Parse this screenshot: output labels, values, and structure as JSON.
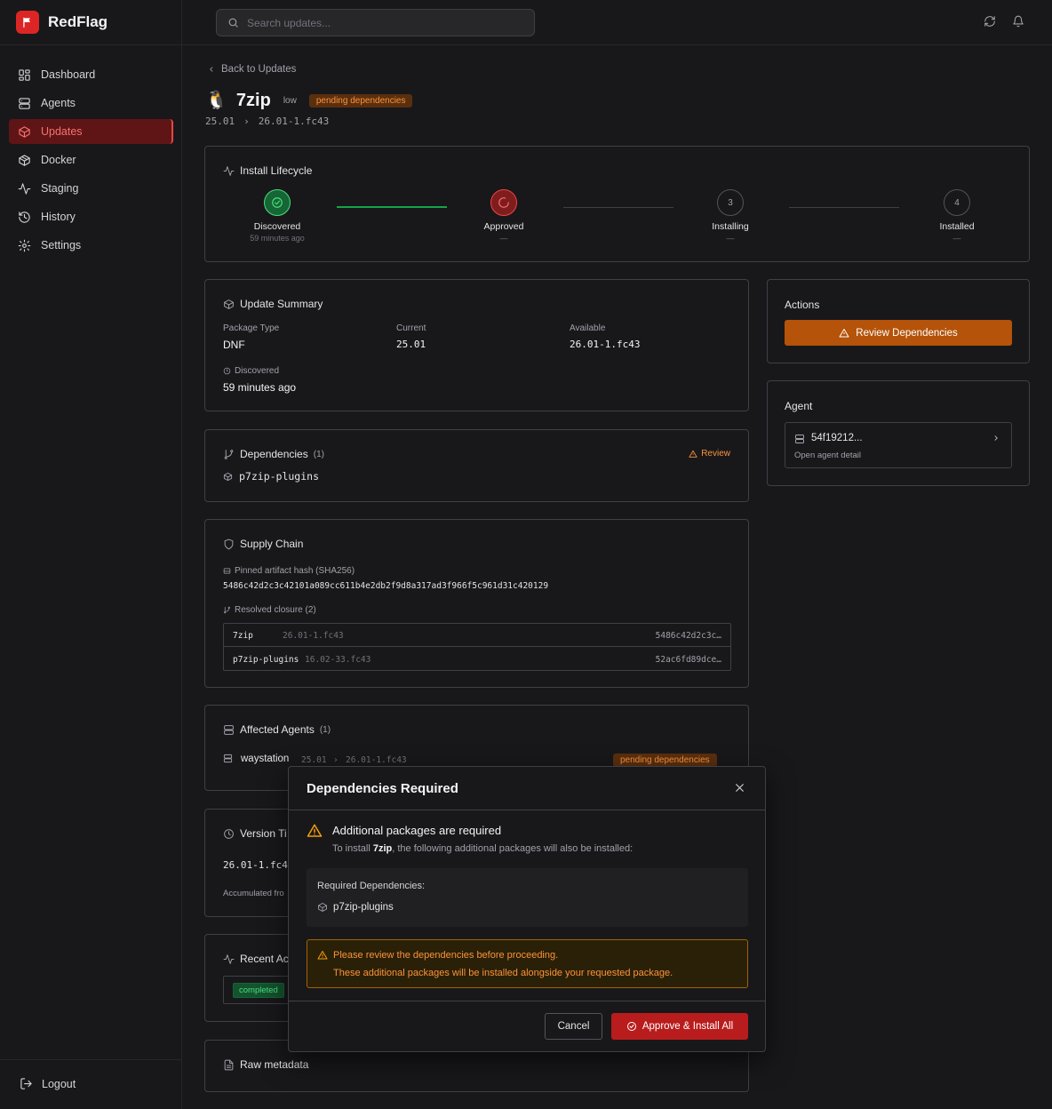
{
  "app": {
    "name": "RedFlag"
  },
  "nav": {
    "items": [
      {
        "label": "Dashboard",
        "icon": "layout-dashboard-icon"
      },
      {
        "label": "Agents",
        "icon": "server-icon"
      },
      {
        "label": "Updates",
        "icon": "package-icon",
        "active": true
      },
      {
        "label": "Docker",
        "icon": "container-icon"
      },
      {
        "label": "Staging",
        "icon": "activity-icon"
      },
      {
        "label": "History",
        "icon": "history-icon"
      },
      {
        "label": "Settings",
        "icon": "gear-icon"
      }
    ],
    "logout": "Logout"
  },
  "topbar": {
    "search_placeholder": "Search updates..."
  },
  "header": {
    "back": "Back to Updates",
    "package": "7zip",
    "severity": "low",
    "status": "pending dependencies",
    "current_version": "25.01",
    "arrow": "›",
    "available_version": "26.01-1.fc43"
  },
  "lifecycle": {
    "title": "Install Lifecycle",
    "stages": [
      {
        "label": "Discovered",
        "sub": "59 minutes ago",
        "state": "done"
      },
      {
        "label": "Approved",
        "sub": "—",
        "state": "current"
      },
      {
        "label": "Installing",
        "sub": "—",
        "state": "pending",
        "num": "3"
      },
      {
        "label": "Installed",
        "sub": "—",
        "state": "pending",
        "num": "4"
      }
    ]
  },
  "summary": {
    "title": "Update Summary",
    "package_type_label": "Package Type",
    "package_type": "DNF",
    "current_label": "Current",
    "current": "25.01",
    "available_label": "Available",
    "available": "26.01-1.fc43",
    "discovered_label": "Discovered",
    "discovered": "59 minutes ago"
  },
  "dependencies": {
    "title": "Dependencies",
    "count": "(1)",
    "review": "Review",
    "items": [
      "p7zip-plugins"
    ]
  },
  "supply_chain": {
    "title": "Supply Chain",
    "hash_label": "Pinned artifact hash (SHA256)",
    "hash": "5486c42d2c3c42101a089cc611b4e2db2f9d8a317ad3f966f5c961d31c420129",
    "closure_label": "Resolved closure (2)",
    "closure": [
      {
        "name": "7zip",
        "version": "26.01-1.fc43",
        "hash": "5486c42d2c3c…"
      },
      {
        "name": "p7zip-plugins",
        "version": "16.02-33.fc43",
        "hash": "52ac6fd89dce…"
      }
    ]
  },
  "affected": {
    "title": "Affected Agents",
    "count": "(1)",
    "agent": "waystation",
    "from": "25.01",
    "arrow": "›",
    "to": "26.01-1.fc43",
    "status": "pending dependencies"
  },
  "version_timeline": {
    "title": "Version Ti",
    "value": "26.01-1.fc4",
    "footer": "Accumulated fro"
  },
  "recent": {
    "title": "Recent Ac",
    "badge": "completed"
  },
  "raw": {
    "title": "Raw metadata"
  },
  "actions": {
    "title": "Actions",
    "button": "Review Dependencies"
  },
  "agent_card": {
    "title": "Agent",
    "id": "54f19212...",
    "sub": "Open agent detail"
  },
  "modal": {
    "title": "Dependencies Required",
    "heading": "Additional packages are required",
    "desc_pre": "To install ",
    "desc_pkg": "7zip",
    "desc_post": ", the following additional packages will also be installed:",
    "deps_label": "Required Dependencies:",
    "deps": [
      "p7zip-plugins"
    ],
    "warn_line1": "Please review the dependencies before proceeding.",
    "warn_line2": "These additional packages will be installed alongside your requested package.",
    "cancel": "Cancel",
    "approve": "Approve & Install All"
  },
  "colors": {
    "accent": "#dc2626",
    "warning": "#f59e0b",
    "success": "#16a34a",
    "action_button": "#b45309"
  }
}
